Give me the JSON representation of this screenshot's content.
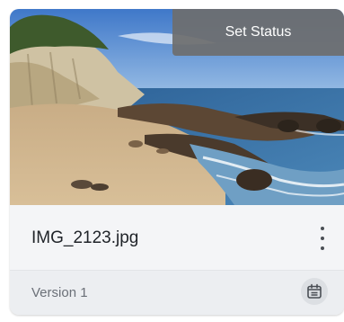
{
  "card": {
    "status_button_label": "Set Status",
    "file_name": "IMG_2123.jpg",
    "version_label": "Version 1",
    "thumbnail_icon": "photo-thumbnail",
    "menu_icon": "more-vert-icon",
    "schedule_icon": "calendar-icon"
  },
  "colors": {
    "status_overlay": "#6e6e6e",
    "card_background": "#f4f5f7",
    "footer_background": "#eceef1",
    "title_text": "#1f2328",
    "secondary_text": "#6b7078"
  }
}
